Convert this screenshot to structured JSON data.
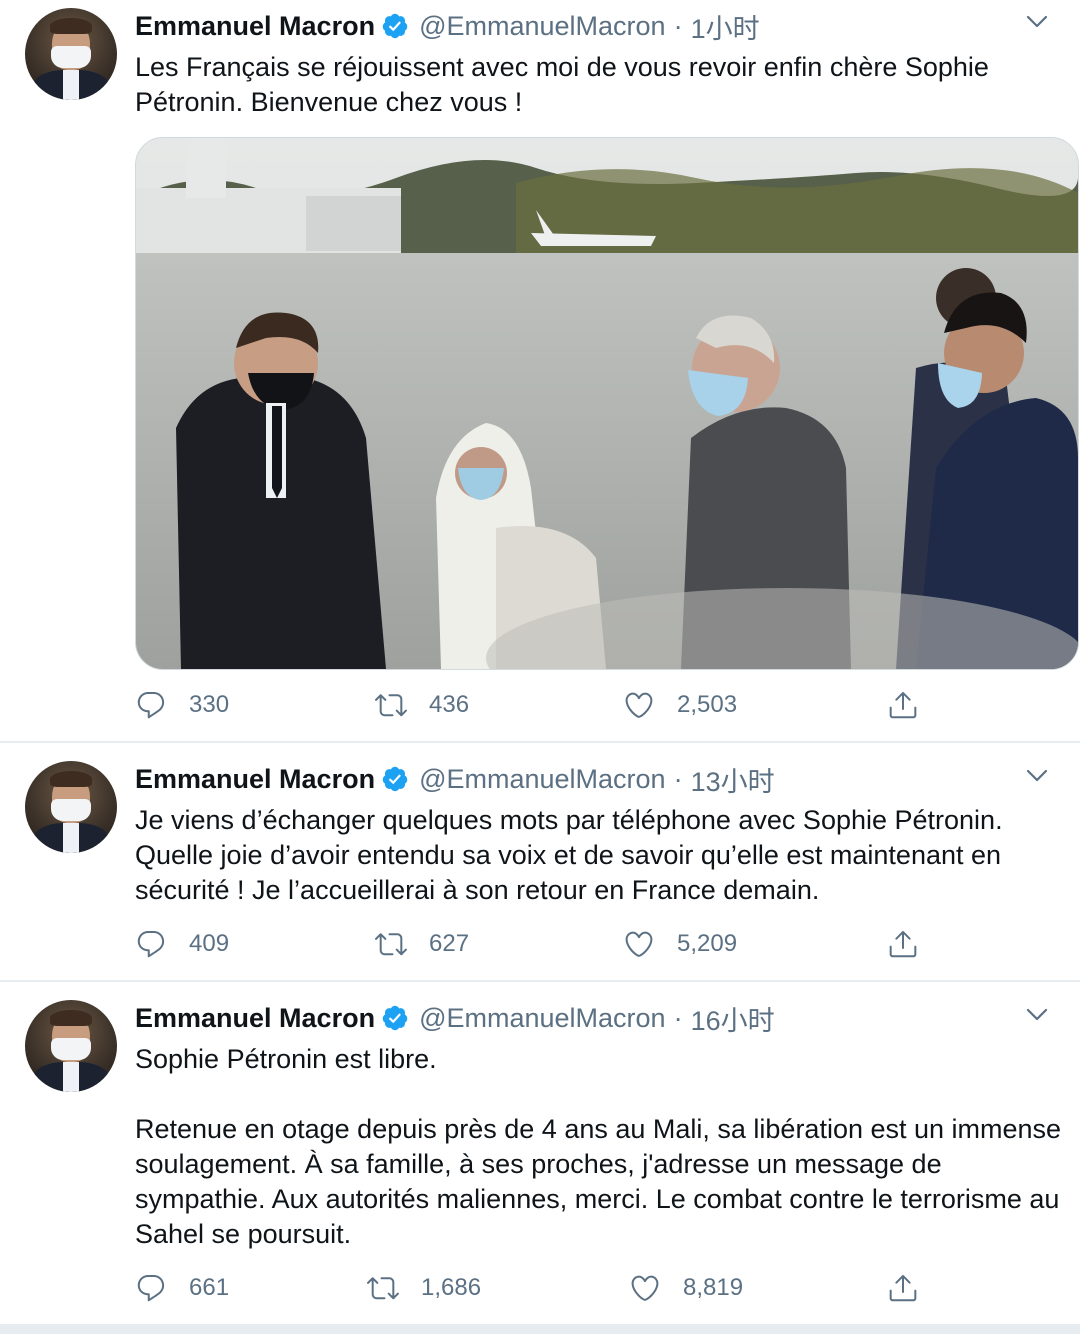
{
  "colors": {
    "text": "#0f1419",
    "secondary": "#5b7083",
    "verified": "#1da1f2",
    "divider": "#e6ecf0"
  },
  "tweets": [
    {
      "author_name": "Emmanuel Macron",
      "handle": "@EmmanuelMacron",
      "separator": "·",
      "time": "1小时",
      "text": "Les Français se réjouissent avec moi de vous revoir enfin chère Sophie Pétronin. Bienvenue chez vous !",
      "has_image": true,
      "replies": "330",
      "retweets": "436",
      "likes": "2,503"
    },
    {
      "author_name": "Emmanuel Macron",
      "handle": "@EmmanuelMacron",
      "separator": "·",
      "time": "13小时",
      "text": "Je viens d’échanger quelques mots par téléphone avec Sophie Pétronin. Quelle joie d’avoir entendu sa voix et de savoir qu’elle est maintenant en sécurité ! Je l’accueillerai à son retour en France demain.",
      "has_image": false,
      "replies": "409",
      "retweets": "627",
      "likes": "5,209"
    },
    {
      "author_name": "Emmanuel Macron",
      "handle": "@EmmanuelMacron",
      "separator": "·",
      "time": "16小时",
      "text": "Sophie Pétronin est libre.\n\nRetenue en otage depuis près de 4 ans au Mali, sa libération est un immense soulagement. À sa famille, à ses proches, j'adresse un message de sympathie. Aux autorités maliennes, merci. Le combat contre le terrorisme au Sahel se poursuit.",
      "has_image": false,
      "replies": "661",
      "retweets": "1,686",
      "likes": "8,819"
    }
  ],
  "icons": {
    "reply": "reply-icon",
    "retweet": "retweet-icon",
    "like": "like-icon",
    "share": "share-icon",
    "verified": "verified-badge-icon",
    "more": "chevron-down-icon"
  }
}
